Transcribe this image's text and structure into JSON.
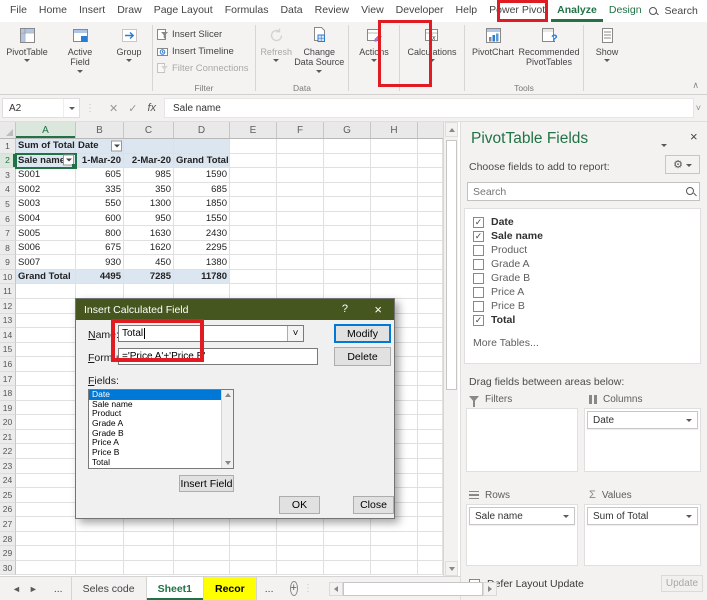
{
  "menu": {
    "tabs": [
      "File",
      "Home",
      "Insert",
      "Draw",
      "Page Layout",
      "Formulas",
      "Data",
      "Review",
      "View",
      "Developer",
      "Help",
      "Power Pivot",
      "Analyze",
      "Design"
    ],
    "active_tab": "Analyze",
    "contextual_tabs": [
      "Analyze",
      "Design"
    ],
    "search_label": "Search"
  },
  "ribbon": {
    "pivottable": "PivotTable",
    "active_field": "Active Field",
    "group": "Group",
    "insert_slicer": "Insert Slicer",
    "insert_timeline": "Insert Timeline",
    "filter_connections": "Filter Connections",
    "filter_group_label": "Filter",
    "refresh": "Refresh",
    "change_data_source": "Change Data Source",
    "data_group_label": "Data",
    "actions": "Actions",
    "calculations": "Calculations",
    "pivotchart": "PivotChart",
    "recommended_pivottables": "Recommended PivotTables",
    "tools_group_label": "Tools",
    "show": "Show"
  },
  "formula_bar": {
    "name_box": "A2",
    "content": "Sale name"
  },
  "grid": {
    "columns": [
      "A",
      "B",
      "C",
      "D",
      "E",
      "F",
      "G",
      "H"
    ],
    "row_count": 30,
    "selected_cell": "A2",
    "cells": [
      {
        "r": 1,
        "c": "A",
        "v": "Sum of Total",
        "bold": true,
        "hdr": true
      },
      {
        "r": 1,
        "c": "B",
        "v": "Date",
        "bold": true,
        "hdr": true,
        "filter": true
      },
      {
        "r": 1,
        "c": "C",
        "v": "",
        "hdr": true
      },
      {
        "r": 1,
        "c": "D",
        "v": "",
        "hdr": true
      },
      {
        "r": 2,
        "c": "A",
        "v": "Sale name",
        "bold": true,
        "hdr": true,
        "filter": true,
        "selected": true
      },
      {
        "r": 2,
        "c": "B",
        "v": "1-Mar-20",
        "bold": true,
        "hdr": true,
        "num": true
      },
      {
        "r": 2,
        "c": "C",
        "v": "2-Mar-20",
        "bold": true,
        "hdr": true,
        "num": true
      },
      {
        "r": 2,
        "c": "D",
        "v": "Grand Total",
        "bold": true,
        "hdr": true
      },
      {
        "r": 3,
        "c": "A",
        "v": "S001"
      },
      {
        "r": 3,
        "c": "B",
        "v": "605",
        "num": true
      },
      {
        "r": 3,
        "c": "C",
        "v": "985",
        "num": true
      },
      {
        "r": 3,
        "c": "D",
        "v": "1590",
        "num": true
      },
      {
        "r": 4,
        "c": "A",
        "v": "S002"
      },
      {
        "r": 4,
        "c": "B",
        "v": "335",
        "num": true
      },
      {
        "r": 4,
        "c": "C",
        "v": "350",
        "num": true
      },
      {
        "r": 4,
        "c": "D",
        "v": "685",
        "num": true
      },
      {
        "r": 5,
        "c": "A",
        "v": "S003"
      },
      {
        "r": 5,
        "c": "B",
        "v": "550",
        "num": true
      },
      {
        "r": 5,
        "c": "C",
        "v": "1300",
        "num": true
      },
      {
        "r": 5,
        "c": "D",
        "v": "1850",
        "num": true
      },
      {
        "r": 6,
        "c": "A",
        "v": "S004"
      },
      {
        "r": 6,
        "c": "B",
        "v": "600",
        "num": true
      },
      {
        "r": 6,
        "c": "C",
        "v": "950",
        "num": true
      },
      {
        "r": 6,
        "c": "D",
        "v": "1550",
        "num": true
      },
      {
        "r": 7,
        "c": "A",
        "v": "S005"
      },
      {
        "r": 7,
        "c": "B",
        "v": "800",
        "num": true
      },
      {
        "r": 7,
        "c": "C",
        "v": "1630",
        "num": true
      },
      {
        "r": 7,
        "c": "D",
        "v": "2430",
        "num": true
      },
      {
        "r": 8,
        "c": "A",
        "v": "S006"
      },
      {
        "r": 8,
        "c": "B",
        "v": "675",
        "num": true
      },
      {
        "r": 8,
        "c": "C",
        "v": "1620",
        "num": true
      },
      {
        "r": 8,
        "c": "D",
        "v": "2295",
        "num": true
      },
      {
        "r": 9,
        "c": "A",
        "v": "S007"
      },
      {
        "r": 9,
        "c": "B",
        "v": "930",
        "num": true
      },
      {
        "r": 9,
        "c": "C",
        "v": "450",
        "num": true
      },
      {
        "r": 9,
        "c": "D",
        "v": "1380",
        "num": true
      },
      {
        "r": 10,
        "c": "A",
        "v": "Grand Total",
        "bold": true,
        "hdr": true
      },
      {
        "r": 10,
        "c": "B",
        "v": "4495",
        "bold": true,
        "hdr": true,
        "num": true
      },
      {
        "r": 10,
        "c": "C",
        "v": "7285",
        "bold": true,
        "hdr": true,
        "num": true
      },
      {
        "r": 10,
        "c": "D",
        "v": "11780",
        "bold": true,
        "hdr": true,
        "num": true
      }
    ]
  },
  "dialog": {
    "title": "Insert Calculated Field",
    "name_label": "Name:",
    "name_value": "Total",
    "formula_label": "Formula:",
    "formula_value": "='Price A'+'Price B'",
    "modify_label": "Modify",
    "delete_label": "Delete",
    "fields_label": "Fields:",
    "fields": [
      "Date",
      "Sale name",
      "Product",
      "Grade A",
      "Grade B",
      "Price A",
      "Price B",
      "Total"
    ],
    "selected_field": "Date",
    "insert_field_label": "Insert Field",
    "ok_label": "OK",
    "close_label": "Close"
  },
  "pane": {
    "title": "PivotTable Fields",
    "choose_label": "Choose fields to add to report:",
    "search_placeholder": "Search",
    "fields": [
      {
        "label": "Date",
        "checked": true
      },
      {
        "label": "Sale name",
        "checked": true
      },
      {
        "label": "Product",
        "checked": false
      },
      {
        "label": "Grade A",
        "checked": false
      },
      {
        "label": "Grade B",
        "checked": false
      },
      {
        "label": "Price A",
        "checked": false
      },
      {
        "label": "Price B",
        "checked": false
      },
      {
        "label": "Total",
        "checked": true
      }
    ],
    "more_tables_label": "More Tables...",
    "drag_hint": "Drag fields between areas below:",
    "areas": {
      "filters": {
        "label": "Filters",
        "items": []
      },
      "columns": {
        "label": "Columns",
        "items": [
          "Date"
        ]
      },
      "rows": {
        "label": "Rows",
        "items": [
          "Sale name"
        ]
      },
      "values": {
        "label": "Values",
        "items": [
          "Sum of Total"
        ]
      }
    },
    "defer_label": "Defer Layout Update",
    "update_label": "Update"
  },
  "sheet_tabs": {
    "tabs": [
      {
        "label": "Seles code",
        "active": false,
        "highlight": false
      },
      {
        "label": "Sheet1",
        "active": true,
        "highlight": false
      },
      {
        "label": "Recor",
        "active": false,
        "highlight": true
      }
    ],
    "overflow_indicator": "...",
    "active_tab": "Sheet1"
  },
  "icons": {
    "fx": "fx",
    "close": "×",
    "help": "?",
    "sigma": "Σ",
    "gear": "⚙",
    "collapse": "∧"
  },
  "colors": {
    "excel_green": "#217346",
    "annotation_red": "#e11b22",
    "dialog_title_bg": "#46561f",
    "pivot_header_blue": "#dce6f1",
    "selection_blue": "#0078d7",
    "highlight_yellow": "#ffff00"
  }
}
